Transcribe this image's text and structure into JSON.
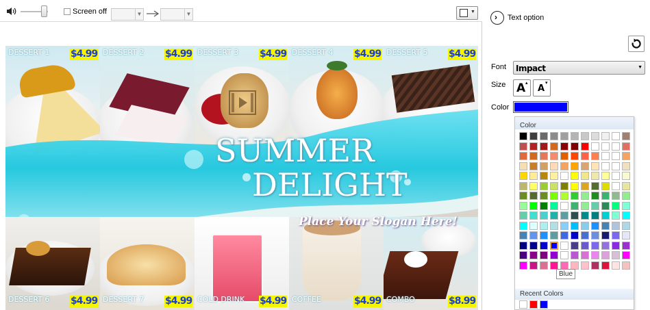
{
  "toolbar": {
    "volume_icon": "speaker-icon",
    "screen_off_label": "Screen off",
    "arrow_icon": "right-arrow-icon",
    "screen_select_icon": "screen-layout-icon"
  },
  "canvas": {
    "tiles": [
      {
        "label": "DESSERT 1",
        "price": "$4.99"
      },
      {
        "label": "DESSERT 2",
        "price": "$4.99"
      },
      {
        "label": "DESSERT 3",
        "price": "$4.99"
      },
      {
        "label": "DESSERT 4",
        "price": "$4.99"
      },
      {
        "label": "DESSERT 5",
        "price": "$4.99"
      },
      {
        "label": "DESSERT 6",
        "price": "$4.99"
      },
      {
        "label": "DESSERT 7",
        "price": "$4.99"
      },
      {
        "label": "COLD DRINK",
        "price": "$4.99"
      },
      {
        "label": "COFFEE",
        "price": "$4.99"
      },
      {
        "label": "COMBO",
        "price": "$8.99"
      }
    ],
    "headline_line1": "SUMMER",
    "headline_line2": "DELIGHT",
    "slogan": "Place Your Slogan Here!",
    "video_icon": "video-film-icon"
  },
  "panel": {
    "title": "Text option",
    "reset_icon": "rotate-reset-icon",
    "font_label": "Font",
    "font_value": "Impact",
    "size_label": "Size",
    "size_increase": "A",
    "size_decrease": "A",
    "color_label": "Color",
    "color_value": "#0000ff"
  },
  "color_picker": {
    "header": "Color",
    "tooltip": "Blue",
    "recent_header": "Recent Colors",
    "grid": [
      [
        "#000000",
        "#3f3f3f",
        "#6b6b6b",
        "#8c8c8c",
        "#a0a0a0",
        "#b4b4b4",
        "#c8c8c8",
        "#dcdcdc",
        "#f0f0f0",
        "#ffffff",
        "#a08070"
      ],
      [
        "#c0504d",
        "#b22222",
        "#a01a1a",
        "#d2691e",
        "#8b0000",
        "#800000",
        "#ff0000",
        "#ffffff",
        "#ffffff",
        "#ffffff",
        "#e07060"
      ],
      [
        "#e06a3c",
        "#d2691e",
        "#e5775a",
        "#f28c6a",
        "#e06000",
        "#ff4500",
        "#ff6347",
        "#ff7f50",
        "#ffffff",
        "#ffffff",
        "#f4a460"
      ],
      [
        "#f5deb3",
        "#c87f2b",
        "#d2a060",
        "#ffdab9",
        "#f4a460",
        "#ffa500",
        "#daa570",
        "#ffe4b5",
        "#ffffff",
        "#ffffff",
        "#f0e0c0"
      ],
      [
        "#ffd700",
        "#ffeb99",
        "#b8860b",
        "#fff0a0",
        "#ffffff",
        "#ffff00",
        "#f0e68c",
        "#eee8aa",
        "#ffff99",
        "#ffffff",
        "#fafad2"
      ],
      [
        "#bdb76b",
        "#ffff66",
        "#9acd32",
        "#c9e265",
        "#808000",
        "#ffff00",
        "#daa520",
        "#556b2f",
        "#dddd00",
        "#ffffff",
        "#e6e6a0"
      ],
      [
        "#6b8e23",
        "#556b2f",
        "#6b8e23",
        "#7cfc00",
        "#adff2f",
        "#32cd32",
        "#90ee90",
        "#228b22",
        "#3cb371",
        "#8fbc8f",
        "#90ee90"
      ],
      [
        "#98fb98",
        "#00ff00",
        "#008000",
        "#00fa9a",
        "#ffffff",
        "#3cb371",
        "#90ee90",
        "#66cdaa",
        "#2e8b57",
        "#00ff7f",
        "#7fffd4"
      ],
      [
        "#66cdaa",
        "#40e0d0",
        "#48d1cc",
        "#20b2aa",
        "#5f9ea0",
        "#2f4f4f",
        "#008b8b",
        "#008080",
        "#00ced1",
        "#7fffd4",
        "#00ffff"
      ],
      [
        "#00ffff",
        "#e0ffff",
        "#afeeee",
        "#b0e0e6",
        "#87cefa",
        "#00bfff",
        "#87ceeb",
        "#1e90ff",
        "#4682b4",
        "#b0c4de",
        "#add8e6"
      ],
      [
        "#4682b4",
        "#6495ed",
        "#1e90ff",
        "#5f9ea0",
        "#4169e1",
        "#0000cd",
        "#4b6fd0",
        "#6a8fe0",
        "#191970",
        "#7b68ee",
        "#e6e6fa"
      ],
      [
        "#000080",
        "#00008b",
        "#0000cd",
        "#0000ff",
        "#ffffff",
        "#483d8b",
        "#6a5acd",
        "#7b68ee",
        "#9370db",
        "#8a2be2",
        "#9932cc"
      ],
      [
        "#4b0082",
        "#8b008b",
        "#800080",
        "#9400d3",
        "#ffffff",
        "#ba55d3",
        "#da70d6",
        "#ee82ee",
        "#dda0dd",
        "#d8bfd8",
        "#ff00ff"
      ],
      [
        "#ff00ff",
        "#c71585",
        "#db7093",
        "#ff1493",
        "#ff69b4",
        "#ffb6c1",
        "#ffc0cb",
        "#b03060",
        "#dc143c",
        "#ffe4e1",
        "#f5c0c0"
      ]
    ],
    "recent": [
      "#ffffff",
      "#ff0000",
      "#0000ff"
    ]
  }
}
